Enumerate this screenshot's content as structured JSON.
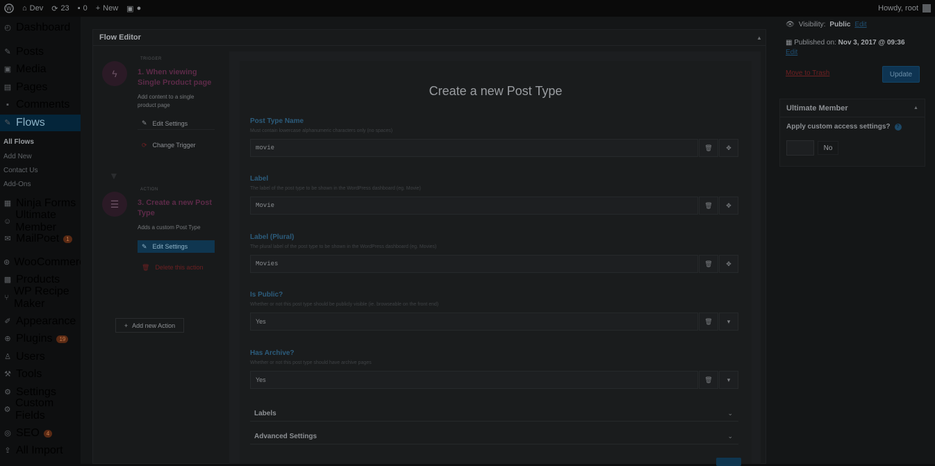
{
  "admin_bar": {
    "site_name": "Dev",
    "updates_count": "23",
    "comments_count": "0",
    "new_label": "New",
    "howdy": "Howdy, root"
  },
  "sidebar": {
    "items": [
      {
        "label": "Dashboard",
        "icon": "dashboard-icon"
      },
      {
        "label": "Posts",
        "icon": "pin-icon"
      },
      {
        "label": "Media",
        "icon": "media-icon"
      },
      {
        "label": "Pages",
        "icon": "pages-icon"
      },
      {
        "label": "Comments",
        "icon": "comment-icon"
      },
      {
        "label": "Flows",
        "icon": "pin-icon"
      },
      {
        "label": "Ninja Forms",
        "icon": "forms-icon"
      },
      {
        "label": "Ultimate Member",
        "icon": "users-icon"
      },
      {
        "label": "MailPoet",
        "icon": "mail-icon",
        "badge": "1"
      },
      {
        "label": "WooCommerce",
        "icon": "woo-icon"
      },
      {
        "label": "Products",
        "icon": "box-icon"
      },
      {
        "label": "WP Recipe Maker",
        "icon": "fork-icon"
      },
      {
        "label": "Appearance",
        "icon": "brush-icon"
      },
      {
        "label": "Plugins",
        "icon": "plug-icon",
        "badge": "19"
      },
      {
        "label": "Users",
        "icon": "user-icon"
      },
      {
        "label": "Tools",
        "icon": "wrench-icon"
      },
      {
        "label": "Settings",
        "icon": "settings-icon"
      },
      {
        "label": "Custom Fields",
        "icon": "gear-icon"
      },
      {
        "label": "SEO",
        "icon": "seo-icon",
        "badge": "4"
      },
      {
        "label": "All Import",
        "icon": "import-icon"
      }
    ],
    "sub_items": [
      "All Flows",
      "Add New",
      "Contact Us",
      "Add-Ons"
    ]
  },
  "flow_editor": {
    "title": "Flow Editor",
    "trigger": {
      "tag": "TRIGGER",
      "title": "1. When viewing Single Product page",
      "description": "Add content to a single product page",
      "edit_label": "Edit Settings",
      "change_label": "Change Trigger"
    },
    "action": {
      "tag": "ACTION",
      "title": "3. Create a new Post Type",
      "description": "Adds a custom Post Type",
      "edit_label": "Edit Settings",
      "delete_label": "Delete this action"
    },
    "add_action_label": "Add new Action"
  },
  "form": {
    "title": "Create a new Post Type",
    "fields": [
      {
        "label": "Post Type Name",
        "help": "Must contain lowercase alphanumeric characters only (no spaces)",
        "value": "movie",
        "mono": true,
        "kind": "text"
      },
      {
        "label": "Label",
        "help": "The label of the post type to be shown in the WordPress dashboard (eg. Movie)",
        "value": "Movie",
        "mono": true,
        "kind": "text"
      },
      {
        "label": "Label (Plural)",
        "help": "The plural label of the post type to be shown in the WordPress dashboard (eg. Movies)",
        "value": "Movies",
        "mono": true,
        "kind": "text"
      },
      {
        "label": "Is Public?",
        "help": "Whether or not this post type should be publicly visible (ie. browseable on the front end)",
        "value": "Yes",
        "mono": false,
        "kind": "select"
      },
      {
        "label": "Has Archive?",
        "help": "Whether or not this post type should have archive pages",
        "value": "Yes",
        "mono": false,
        "kind": "select"
      }
    ],
    "sections": [
      "Labels",
      "Advanced Settings"
    ]
  },
  "publish": {
    "visibility_label": "Visibility:",
    "visibility_value": "Public",
    "edit_link": "Edit",
    "published_label": "Published on:",
    "published_value": "Nov 3, 2017 @ 09:36",
    "trash_label": "Move to Trash",
    "update_label": "Update"
  },
  "ultimate_member": {
    "title": "Ultimate Member",
    "question": "Apply custom access settings?",
    "select_value": "No"
  }
}
